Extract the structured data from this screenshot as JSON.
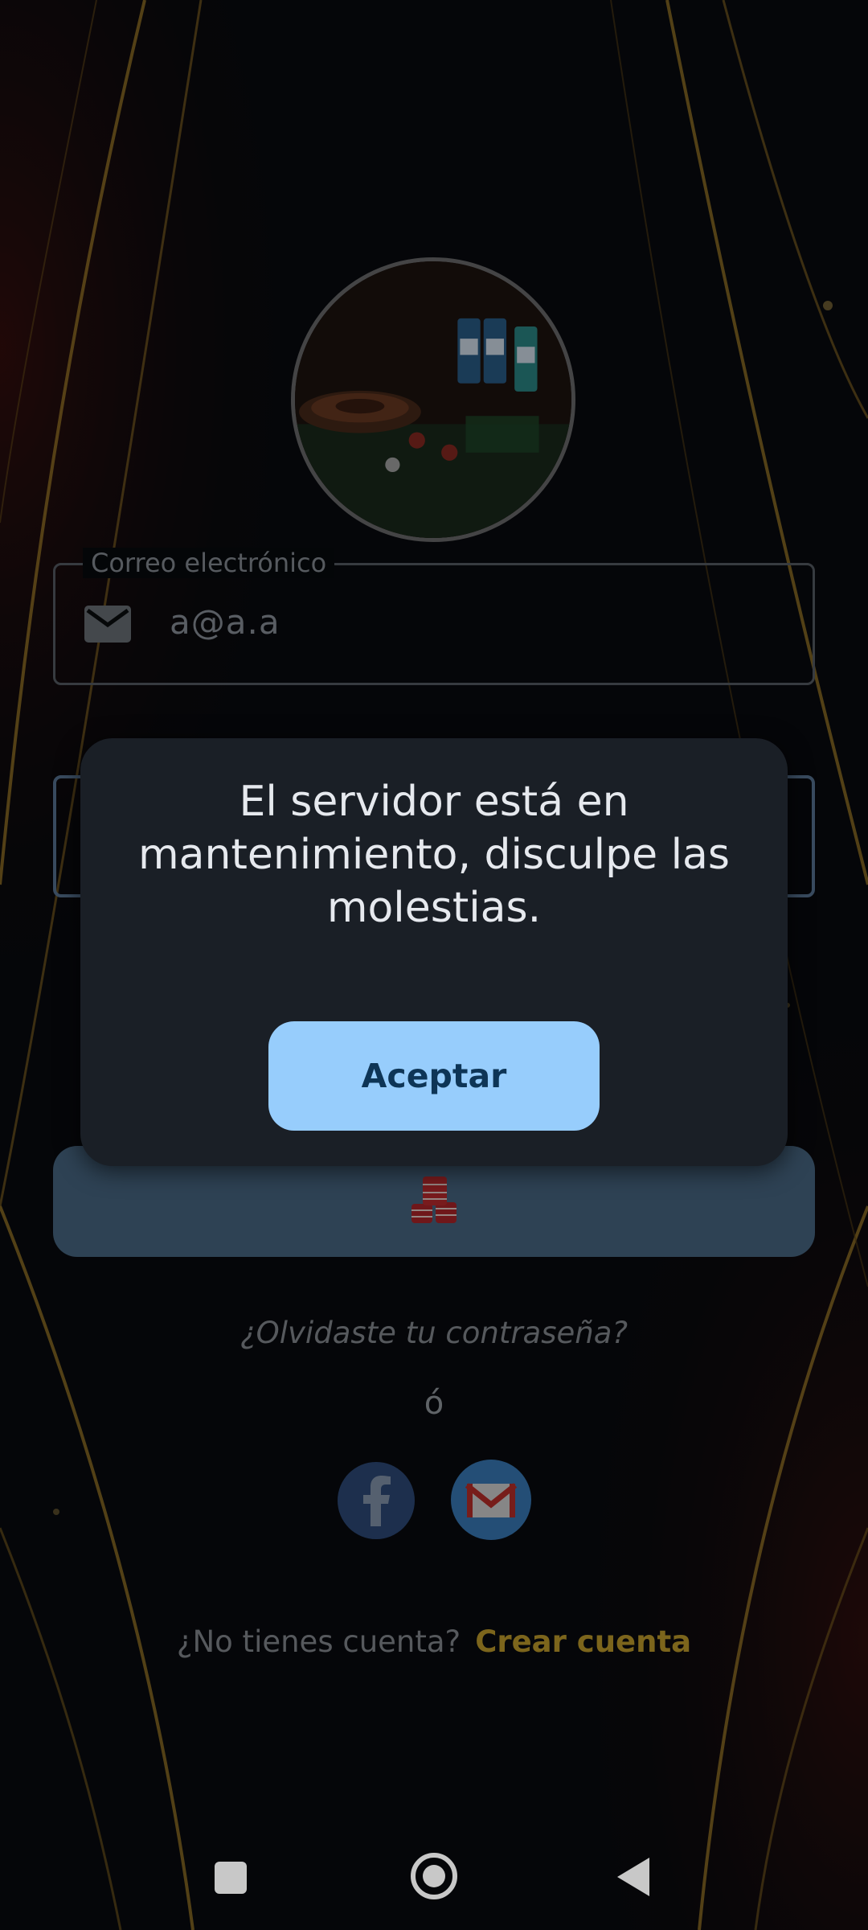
{
  "login": {
    "email": {
      "label": "Correo electrónico",
      "value": "a@a.a",
      "icon": "mail-icon"
    },
    "password_field_icon": "lock-icon",
    "login_button_icon": "casino-chips-icon",
    "forgot_password": "¿Olvidaste tu contraseña?",
    "or_separator": "ó",
    "social": [
      {
        "name": "facebook",
        "icon": "facebook-icon"
      },
      {
        "name": "gmail",
        "icon": "gmail-icon"
      }
    ],
    "signup": {
      "question": "¿No tienes cuenta?",
      "link": "Crear cuenta"
    }
  },
  "dialog": {
    "message": "El servidor está en mantenimiento, disculpe las molestias.",
    "accept_label": "Aceptar"
  },
  "navbar": {
    "items": [
      "recents-icon",
      "home-icon",
      "back-icon"
    ]
  },
  "colors": {
    "accent_gold": "#c9a42e",
    "dialog_bg": "#1a1f26",
    "accept_button": "#97cdfc",
    "login_button": "#4b6b88"
  }
}
